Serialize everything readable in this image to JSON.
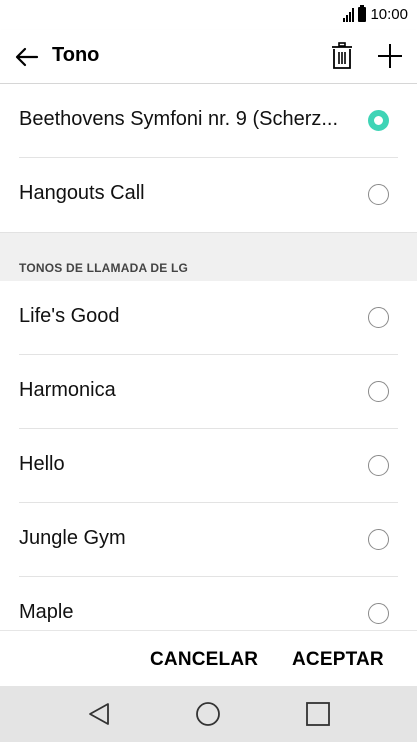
{
  "status_bar": {
    "time": "10:00",
    "icons": [
      "signal-icon",
      "battery-icon"
    ]
  },
  "toolbar": {
    "title": "Tono",
    "back_icon": "arrow-left-icon",
    "delete_icon": "trash-icon",
    "add_icon": "plus-icon"
  },
  "ringtones": {
    "custom": [
      {
        "label": "Beethovens Symfoni nr. 9 (Scherz...",
        "selected": true
      },
      {
        "label": "Hangouts Call",
        "selected": false
      }
    ],
    "section_header": "TONOS DE LLAMADA DE LG",
    "lg": [
      {
        "label": "Life's Good",
        "selected": false
      },
      {
        "label": "Harmonica",
        "selected": false
      },
      {
        "label": "Hello",
        "selected": false
      },
      {
        "label": "Jungle Gym",
        "selected": false
      },
      {
        "label": "Maple",
        "selected": false
      }
    ]
  },
  "actions": {
    "cancel_label": "CANCELAR",
    "accept_label": "ACEPTAR"
  },
  "nav_bar": {
    "icons": [
      "back-triangle-icon",
      "home-circle-icon",
      "recent-square-icon"
    ]
  },
  "colors": {
    "accent": "#3fd4b6",
    "nav_background": "#e4e4e4",
    "section_background": "#f0f0f0"
  }
}
